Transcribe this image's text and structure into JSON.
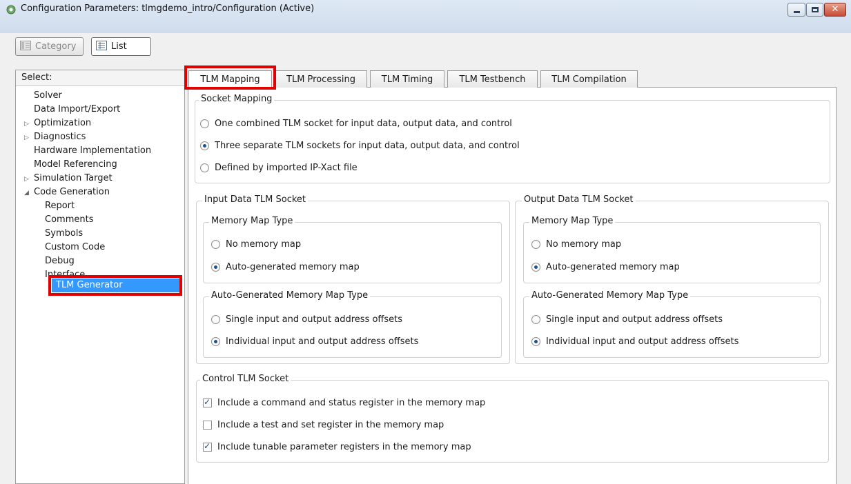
{
  "window": {
    "title": "Configuration Parameters: tlmgdemo_intro/Configuration (Active)"
  },
  "toolbar": {
    "category_label": "Category",
    "list_label": "List"
  },
  "tree": {
    "header": "Select:",
    "items": [
      {
        "label": "Solver",
        "arrow": ""
      },
      {
        "label": "Data Import/Export",
        "arrow": ""
      },
      {
        "label": "Optimization",
        "arrow": "▷"
      },
      {
        "label": "Diagnostics",
        "arrow": "▷"
      },
      {
        "label": "Hardware Implementation",
        "arrow": ""
      },
      {
        "label": "Model Referencing",
        "arrow": ""
      },
      {
        "label": "Simulation Target",
        "arrow": "▷"
      },
      {
        "label": "Code Generation",
        "arrow": "◢"
      },
      {
        "label": "Report",
        "arrow": ""
      },
      {
        "label": "Comments",
        "arrow": ""
      },
      {
        "label": "Symbols",
        "arrow": ""
      },
      {
        "label": "Custom Code",
        "arrow": ""
      },
      {
        "label": "Debug",
        "arrow": ""
      },
      {
        "label": "Interface",
        "arrow": ""
      },
      {
        "label": "TLM Generator",
        "arrow": ""
      }
    ],
    "selected": "TLM Generator"
  },
  "tabs": [
    "TLM Mapping",
    "TLM Processing",
    "TLM Timing",
    "TLM Testbench",
    "TLM Compilation"
  ],
  "active_tab": "TLM Mapping",
  "socket_mapping": {
    "title": "Socket Mapping",
    "options": [
      "One combined TLM socket for input data, output data, and control",
      "Three separate TLM sockets for input data, output data, and control",
      "Defined by imported IP-Xact file"
    ],
    "selected_index": 1
  },
  "input_socket": {
    "title": "Input Data TLM Socket",
    "memory_map_type": {
      "title": "Memory Map Type",
      "options": [
        "No memory map",
        "Auto-generated memory map"
      ],
      "selected_index": 1
    },
    "auto_type": {
      "title": "Auto-Generated Memory Map Type",
      "options": [
        "Single input and output address offsets",
        "Individual input and output address offsets"
      ],
      "selected_index": 1
    }
  },
  "output_socket": {
    "title": "Output Data TLM Socket",
    "memory_map_type": {
      "title": "Memory Map Type",
      "options": [
        "No memory map",
        "Auto-generated memory map"
      ],
      "selected_index": 1
    },
    "auto_type": {
      "title": "Auto-Generated Memory Map Type",
      "options": [
        "Single input and output address offsets",
        "Individual input and output address offsets"
      ],
      "selected_index": 1
    }
  },
  "control_socket": {
    "title": "Control TLM Socket",
    "checkboxes": [
      {
        "label": "Include a command and status register in the memory map",
        "checked": true
      },
      {
        "label": "Include a test and set register in the memory map",
        "checked": false
      },
      {
        "label": "Include tunable parameter registers in the memory map",
        "checked": true
      }
    ]
  },
  "colors": {
    "highlight": "#e10000",
    "selection": "#3399ff"
  }
}
